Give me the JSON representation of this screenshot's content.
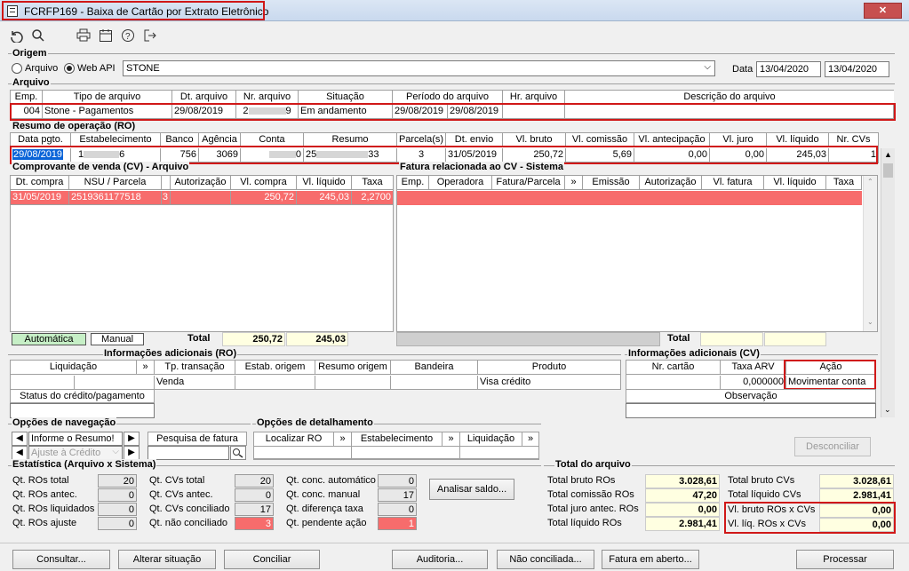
{
  "window": {
    "title": "FCRFP169 - Baixa de Cartão por Extrato Eletrônico",
    "close": "✕"
  },
  "toolbar": {
    "icons": [
      "undo-icon",
      "search-icon",
      "print-icon",
      "calendar-icon",
      "help-icon",
      "exit-icon"
    ]
  },
  "origem": {
    "label": "Origem",
    "opt_arquivo": "Arquivo",
    "opt_webapi": "Web API",
    "value": "STONE",
    "data_label": "Data",
    "data_ini": "13/04/2020",
    "data_fim": "13/04/2020"
  },
  "arquivo": {
    "label": "Arquivo",
    "headers": [
      "Emp.",
      "Tipo de arquivo",
      "Dt. arquivo",
      "Nr. arquivo",
      "Situação",
      "Período do arquivo",
      "",
      "Hr. arquivo",
      "Descrição do arquivo"
    ],
    "row": [
      "004",
      "Stone - Pagamentos",
      "29/08/2019",
      "2",
      "9",
      "Em andamento",
      "29/08/2019",
      "29/08/2019",
      "",
      ""
    ]
  },
  "resumo": {
    "label": "Resumo de operação (RO)",
    "headers": [
      "Data pgto.",
      "Estabelecimento",
      "Banco",
      "Agência",
      "Conta",
      "Resumo",
      "Parcela(s)",
      "Dt. envio",
      "Vl. bruto",
      "Vl. comissão",
      "Vl. antecipação",
      "Vl. juro",
      "Vl. líquido",
      "Nr. CVs"
    ],
    "row": [
      "29/08/2019",
      "1",
      "6",
      "756",
      "3069",
      "0",
      "25",
      "33",
      "3",
      "31/05/2019",
      "250,72",
      "5,69",
      "0,00",
      "0,00",
      "245,03",
      "1"
    ]
  },
  "cv": {
    "label": "Comprovante de venda (CV) - Arquivo",
    "headers": [
      "Dt. compra",
      "NSU / Parcela",
      "",
      "Autorização",
      "Vl. compra",
      "Vl. líquido",
      "Taxa"
    ],
    "row": [
      "31/05/2019",
      "2519361177518",
      "3",
      "",
      "250,72",
      "245,03",
      "2,2700"
    ],
    "btn_auto": "Automática",
    "btn_manual": "Manual",
    "total_label": "Total",
    "total_compra": "250,72",
    "total_liquido": "245,03"
  },
  "fatura": {
    "label": "Fatura relacionada ao CV - Sistema",
    "headers": [
      "Emp.",
      "Operadora",
      "Fatura/Parcela",
      "»",
      "Emissão",
      "Autorização",
      "Vl. fatura",
      "Vl. líquido",
      "Taxa"
    ],
    "total_label": "Total"
  },
  "info_ro": {
    "label": "Informações adicionais (RO)",
    "headers": [
      "Liquidação",
      "»",
      "Tp. transação",
      "Estab. origem",
      "Resumo origem",
      "Bandeira",
      "Produto"
    ],
    "row": [
      "",
      "",
      "Venda",
      "",
      "",
      "",
      "Visa crédito"
    ],
    "status_label": "Status do crédito/pagamento"
  },
  "info_cv": {
    "label": "Informações adicionais (CV)",
    "headers": [
      "Nr. cartão",
      "Taxa ARV",
      "Ação"
    ],
    "row": [
      "",
      "0,000000",
      "Movimentar conta"
    ],
    "obs_label": "Observação"
  },
  "nav": {
    "label": "Opções de navegação",
    "combo1": "Informe o Resumo!",
    "combo2": "Ajuste à Crédito",
    "pesquisa": "Pesquisa de fatura"
  },
  "det": {
    "label": "Opções de detalhamento",
    "items": [
      "Localizar RO",
      "»",
      "Estabelecimento",
      "»",
      "Liquidação",
      "»"
    ]
  },
  "desconciliar": "Desconciliar",
  "estat": {
    "label": "Estatística (Arquivo x Sistema)",
    "col1": [
      [
        "Qt. ROs total",
        "20"
      ],
      [
        "Qt. ROs antec.",
        "0"
      ],
      [
        "Qt. ROs liquidados",
        "0"
      ],
      [
        "Qt. ROs ajuste",
        "0"
      ]
    ],
    "col2": [
      [
        "Qt. CVs total",
        "20"
      ],
      [
        "Qt. CVs antec.",
        "0"
      ],
      [
        "Qt. CVs conciliado",
        "17"
      ],
      [
        "Qt. não conciliado",
        "3"
      ]
    ],
    "col3": [
      [
        "Qt. conc. automático",
        "0"
      ],
      [
        "Qt. conc. manual",
        "17"
      ],
      [
        "Qt. diferença taxa",
        "0"
      ],
      [
        "Qt. pendente ação",
        "1"
      ]
    ],
    "analisar": "Analisar saldo..."
  },
  "total": {
    "label": "Total do arquivo",
    "left": [
      [
        "Total bruto ROs",
        "3.028,61"
      ],
      [
        "Total comissão ROs",
        "47,20"
      ],
      [
        "Total juro antec. ROs",
        "0,00"
      ],
      [
        "Total líquido ROs",
        "2.981,41"
      ]
    ],
    "right": [
      [
        "Total bruto CVs",
        "3.028,61"
      ],
      [
        "Total líquido CVs",
        "2.981,41"
      ],
      [
        "Vl. bruto ROs x CVs",
        "0,00"
      ],
      [
        "Vl. líq. ROs x CVs",
        "0,00"
      ]
    ]
  },
  "buttons": [
    "Consultar...",
    "Alterar situação",
    "Conciliar",
    "Auditoria...",
    "Não conciliada...",
    "Fatura em aberto...",
    "Processar"
  ],
  "colors": {
    "accent": "#d01818",
    "selection": "#0a64d8",
    "highlight_row": "#f76c6c",
    "yellow": "#ffffe1"
  }
}
